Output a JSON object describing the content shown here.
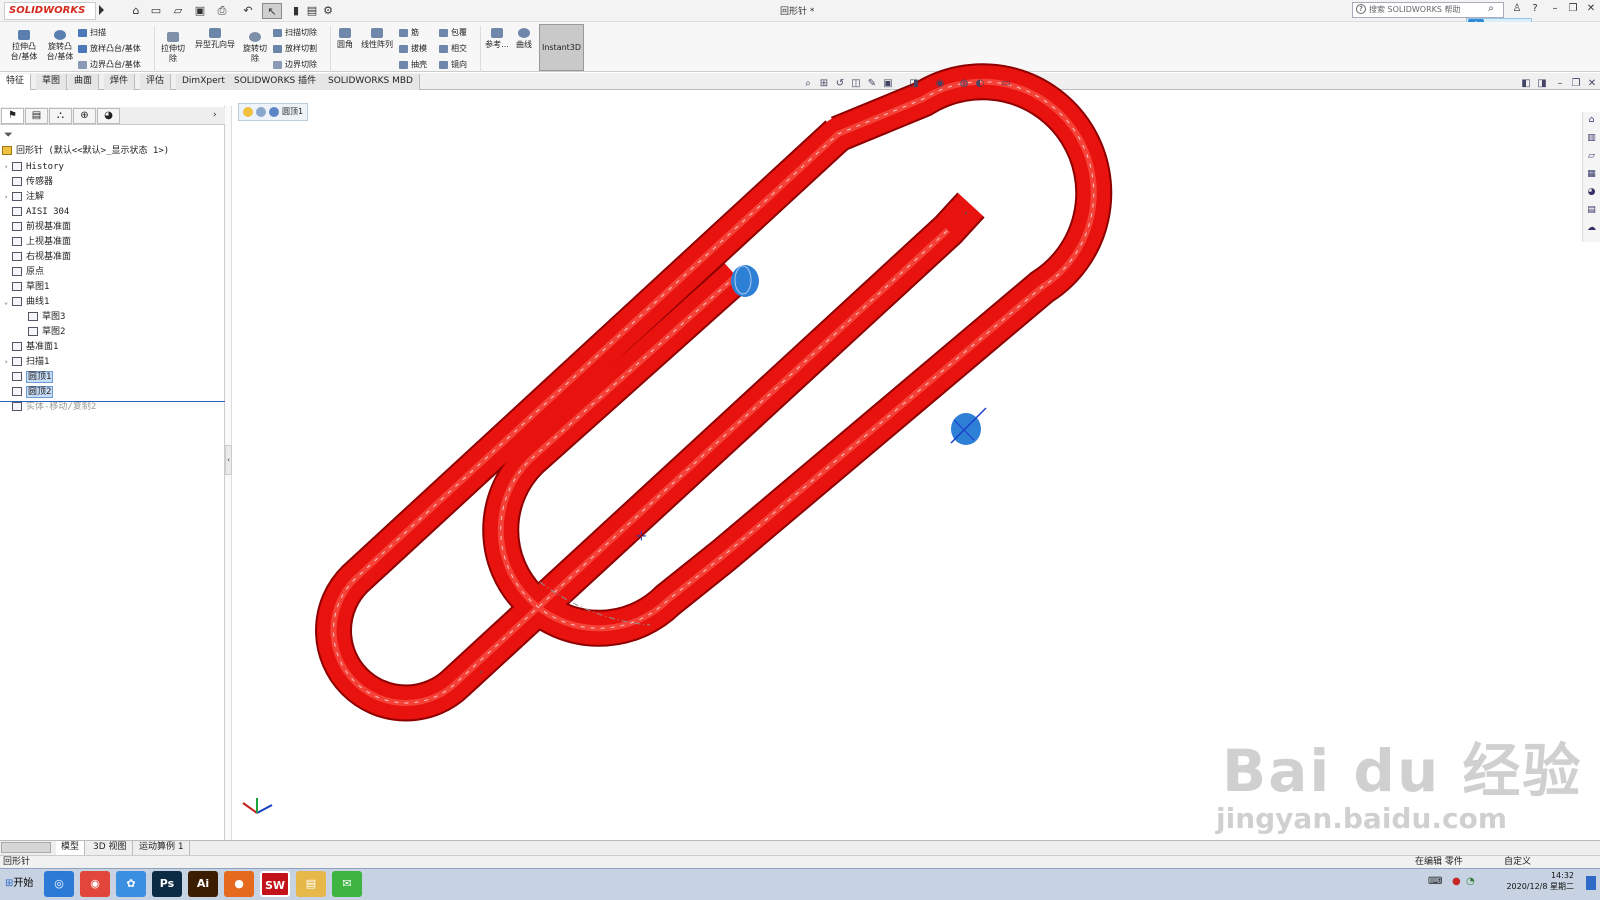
{
  "app": {
    "brand": "SOLIDWORKS",
    "document_title": "回形针 *"
  },
  "help_search": {
    "placeholder": "搜索 SOLIDWORKS 帮助"
  },
  "window_controls": {
    "minimize": "–",
    "restore": "❐",
    "close": "✕",
    "help": "?"
  },
  "ribbon": {
    "extrude_boss": {
      "line1": "拉伸凸",
      "line2": "台/基体"
    },
    "revolve_boss": {
      "line1": "旋转凸",
      "line2": "台/基体"
    },
    "sweep": "扫描",
    "loft_boss": "放样凸台/基体",
    "boundary_boss": "边界凸台/基体",
    "extrude_cut": {
      "line1": "拉伸切",
      "line2": "除"
    },
    "hole_wizard": "异型孔向导",
    "revolve_cut": {
      "line1": "旋转切",
      "line2": "除"
    },
    "swept_cut": "扫描切除",
    "lofted_cut": "放样切割",
    "boundary_cut": "边界切除",
    "fillet": "圆角",
    "linear_pattern": "线性阵列",
    "rib": "筋",
    "draft": "拔模",
    "shell": "抽壳",
    "wrap": "包覆",
    "intersect": "相交",
    "mirror": "镜向",
    "reference": "参考...",
    "curves": "曲线",
    "instant3d": "Instant3D"
  },
  "tabs": [
    {
      "label": "特征",
      "active": true
    },
    {
      "label": "草图",
      "active": false
    },
    {
      "label": "曲面",
      "active": false
    },
    {
      "label": "焊件",
      "active": false
    },
    {
      "label": "评估",
      "active": false
    },
    {
      "label": "DimXpert",
      "active": false
    },
    {
      "label": "SOLIDWORKS 插件",
      "active": false
    },
    {
      "label": "SOLIDWORKS MBD",
      "active": false
    }
  ],
  "tree": {
    "root": "回形针  (默认<<默认>_显示状态 1>)",
    "items": [
      {
        "label": "History",
        "toggle": "›"
      },
      {
        "label": "传感器",
        "toggle": ""
      },
      {
        "label": "注解",
        "toggle": "›"
      },
      {
        "label": "AISI 304",
        "toggle": ""
      },
      {
        "label": "前视基准面",
        "toggle": ""
      },
      {
        "label": "上视基准面",
        "toggle": ""
      },
      {
        "label": "右视基准面",
        "toggle": ""
      },
      {
        "label": "原点",
        "toggle": ""
      },
      {
        "label": "草图1",
        "toggle": ""
      },
      {
        "label": "曲线1",
        "toggle": "⌄"
      },
      {
        "label": "草图3",
        "toggle": ""
      },
      {
        "label": "草图2",
        "toggle": ""
      },
      {
        "label": "基准面1",
        "toggle": ""
      },
      {
        "label": "扫描1",
        "toggle": "›"
      },
      {
        "label": "圆顶1",
        "toggle": ""
      },
      {
        "label": "圆顶2",
        "toggle": ""
      },
      {
        "label": "实体-移动/复制2",
        "toggle": ""
      }
    ]
  },
  "breadcrumb": {
    "label": "圆顶1"
  },
  "bottom_tabs": [
    "模型",
    "3D 视图",
    "运动算例 1"
  ],
  "status": {
    "left": "回形针",
    "editing": "在编辑  零件",
    "units": "自定义"
  },
  "taskbar": {
    "start": "开始",
    "apps": [
      {
        "name": "browser-app",
        "glyph": "◎",
        "color": "#2b7bd6"
      },
      {
        "name": "chrome-app",
        "glyph": "◉",
        "color": "#e2463a"
      },
      {
        "name": "baidu-netdisk-app",
        "glyph": "✿",
        "color": "#3b8fe0"
      },
      {
        "name": "photoshop-app",
        "glyph": "Ps",
        "color": "#0b2a44"
      },
      {
        "name": "illustrator-app",
        "glyph": "Ai",
        "color": "#3b1d00"
      },
      {
        "name": "firefox-app",
        "glyph": "●",
        "color": "#e66a1e"
      },
      {
        "name": "solidworks-app",
        "glyph": "SW",
        "color": "#c4121a"
      },
      {
        "name": "explorer-app",
        "glyph": "▤",
        "color": "#e6b84a"
      },
      {
        "name": "wechat-app",
        "glyph": "✉",
        "color": "#3fb541"
      }
    ],
    "clock_time": "14:32",
    "clock_date": "2020/12/8 星期二"
  },
  "watermark": {
    "main": "Bai du 经验",
    "sub": "jingyan.baidu.com"
  },
  "colors": {
    "part": "#e8130f",
    "accent": "#2e8bd8",
    "brand": "#d52b1e"
  }
}
